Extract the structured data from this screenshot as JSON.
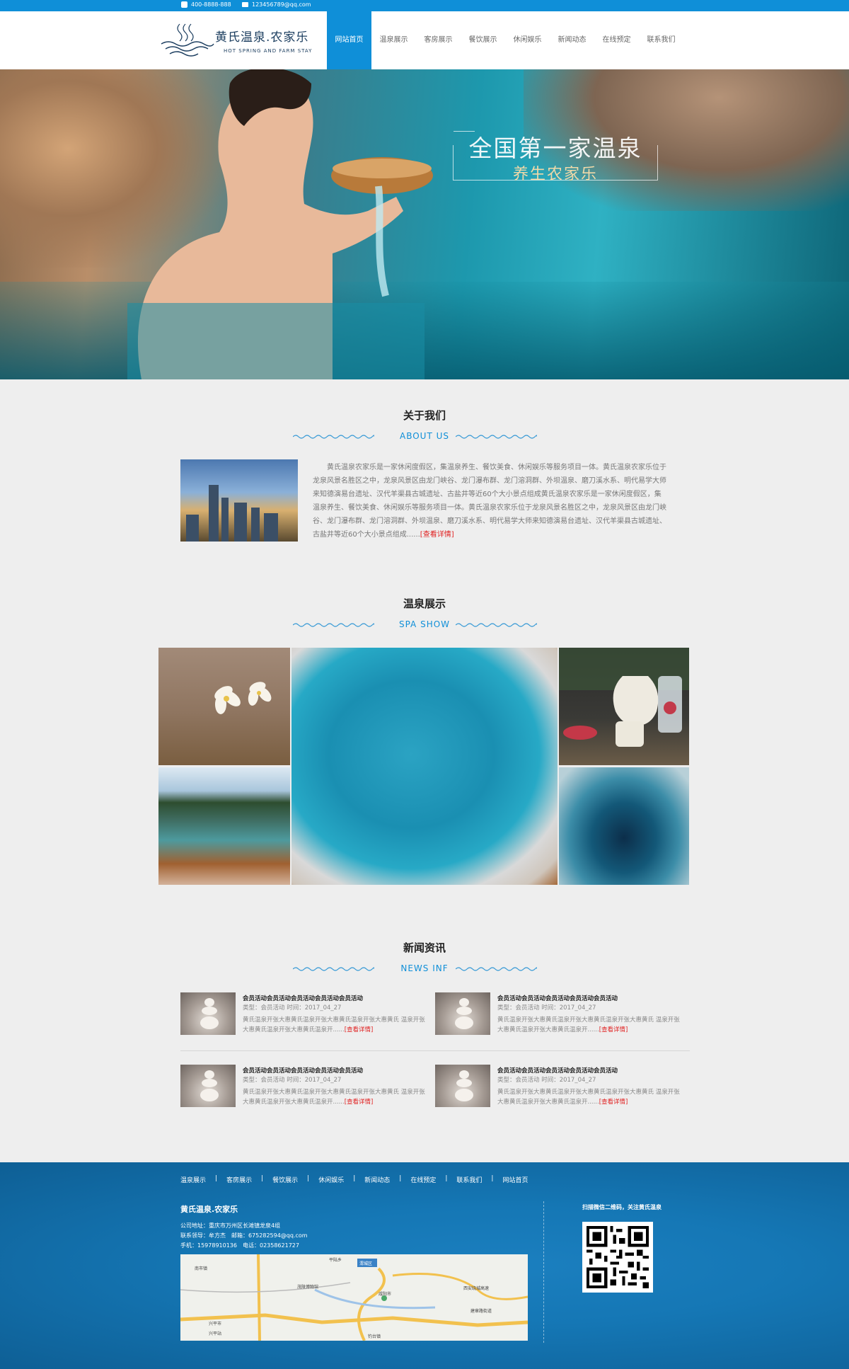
{
  "topbar": {
    "phone": "400-8888-888",
    "email": "123456789@qq.com"
  },
  "logo": {
    "name": "黄氏温泉.农家乐",
    "subtitle": "HOT SPRING AND FARM STAY"
  },
  "nav": [
    {
      "label": "网站首页",
      "active": true
    },
    {
      "label": "温泉展示"
    },
    {
      "label": "客房展示"
    },
    {
      "label": "餐饮展示"
    },
    {
      "label": "休闲娱乐"
    },
    {
      "label": "新闻动态"
    },
    {
      "label": "在线预定"
    },
    {
      "label": "联系我们"
    }
  ],
  "hero": {
    "line1": "全国第一家温泉",
    "line2": "养生农家乐"
  },
  "about": {
    "title": "关于我们",
    "subtitle": "ABOUT US",
    "text": "黄氏温泉农家乐是一家休闲度假区，集温泉养生、餐饮美食、休闲娱乐等服务项目一体。黄氏温泉农家乐位于龙泉风景名胜区之中，龙泉风景区由龙门峡谷、龙门瀑布群、龙门溶洞群、外坝温泉、磨刀溪水系、明代易学大师来知德演易台遗址、汉代羊渠县古城遗址、古盐井等近60个大小景点组成黄氏温泉农家乐是一家休闲度假区，集温泉养生、餐饮美食、休闲娱乐等服务项目一体。黄氏温泉农家乐位于龙泉风景名胜区之中，龙泉风景区由龙门峡谷、龙门瀑布群、龙门溶洞群、外坝温泉、磨刀溪水系、明代易学大师来知德演易台遗址、汉代羊渠县古城遗址、古盐井等近60个大小景点组成......",
    "more": "[查看详情]"
  },
  "spa": {
    "title": "温泉展示",
    "subtitle": "SPA SHOW"
  },
  "news": {
    "title": "新闻资讯",
    "subtitle": "NEWS INF",
    "items": [
      {
        "title": "会员活动会员活动会员活动会员活动会员活动",
        "meta": "类型：会员活动 时间：2017_04_27",
        "desc": "黄氏温泉开张大惠黄氏温泉开张大惠黄氏温泉开张大惠黄氏 温泉开张大惠黄氏温泉开张大惠黄氏温泉开......",
        "more": "[查看详情]"
      },
      {
        "title": "会员活动会员活动会员活动会员活动会员活动",
        "meta": "类型：会员活动 时间：2017_04_27",
        "desc": "黄氏温泉开张大惠黄氏温泉开张大惠黄氏温泉开张大惠黄氏 温泉开张大惠黄氏温泉开张大惠黄氏温泉开......",
        "more": "[查看详情]"
      },
      {
        "title": "会员活动会员活动会员活动会员活动会员活动",
        "meta": "类型：会员活动 时间：2017_04_27",
        "desc": "黄氏温泉开张大惠黄氏温泉开张大惠黄氏温泉开张大惠黄氏 温泉开张大惠黄氏温泉开张大惠黄氏温泉开......",
        "more": "[查看详情]"
      },
      {
        "title": "会员活动会员活动会员活动会员活动会员活动",
        "meta": "类型：会员活动 时间：2017_04_27",
        "desc": "黄氏温泉开张大惠黄氏温泉开张大惠黄氏温泉开张大惠黄氏 温泉开张大惠黄氏温泉开张大惠黄氏温泉开......",
        "more": "[查看详情]"
      }
    ]
  },
  "footer": {
    "nav": [
      "温泉展示",
      "客房展示",
      "餐饮展示",
      "休闲娱乐",
      "新闻动态",
      "在线预定",
      "联系我们",
      "网站首页"
    ],
    "separator": "|",
    "name": "黄氏温泉.农家乐",
    "address": "公司地址：重庆市万州区长滩镇龙泉4组",
    "contact": "联系领导：牟方杰　邮箱：675282594@qq.com",
    "phone": "手机：15978910136　电话：02358621727",
    "map_labels": [
      "南市镇",
      "平陆乡",
      "渭城区",
      "茂陵博物馆",
      "咸阳市",
      "兴平市",
      "兴平站",
      "钓台镇",
      "建章路街道",
      "西安绕城高速"
    ],
    "qr_label": "扫描微信二维码，关注黄氏温泉"
  }
}
